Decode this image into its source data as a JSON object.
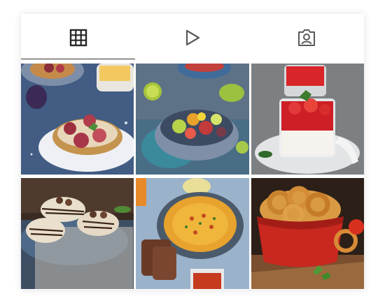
{
  "tabs": [
    {
      "id": "grid",
      "icon": "grid-icon",
      "active": true
    },
    {
      "id": "reels",
      "icon": "play-icon",
      "active": false
    },
    {
      "id": "tagged",
      "icon": "tagged-user-icon",
      "active": false
    }
  ],
  "posts": [
    {
      "subject": "fig-tart-photo"
    },
    {
      "subject": "fruit-salad-bowl-photo"
    },
    {
      "subject": "strawberry-panna-cotta-photo"
    },
    {
      "subject": "chocolate-cream-pastries-photo"
    },
    {
      "subject": "pumpkin-hummus-plate-photo"
    },
    {
      "subject": "fried-onion-rings-bowl-photo"
    }
  ],
  "colors": {
    "icon": "#5a5a5a",
    "icon_active": "#262626",
    "active_underline": "#333333"
  }
}
